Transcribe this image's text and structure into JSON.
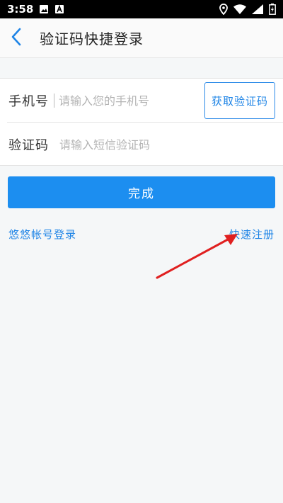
{
  "status_bar": {
    "time": "3:58",
    "icons": [
      "image-icon",
      "a-app-icon",
      "location-icon",
      "wifi-icon",
      "signal-icon",
      "battery-charging-icon"
    ]
  },
  "header": {
    "title": "验证码快捷登录",
    "back_icon": "chevron-left-icon"
  },
  "form": {
    "phone": {
      "label": "手机号",
      "placeholder": "请输入您的手机号",
      "value": ""
    },
    "get_code_button": "获取验证码",
    "code": {
      "label": "验证码",
      "placeholder": "请输入短信验证码",
      "value": ""
    }
  },
  "submit_button": "完成",
  "links": {
    "account_login": "悠悠帐号登录",
    "quick_register": "快速注册"
  },
  "colors": {
    "accent": "#1c8ef0",
    "annotation_arrow": "#e02020"
  }
}
